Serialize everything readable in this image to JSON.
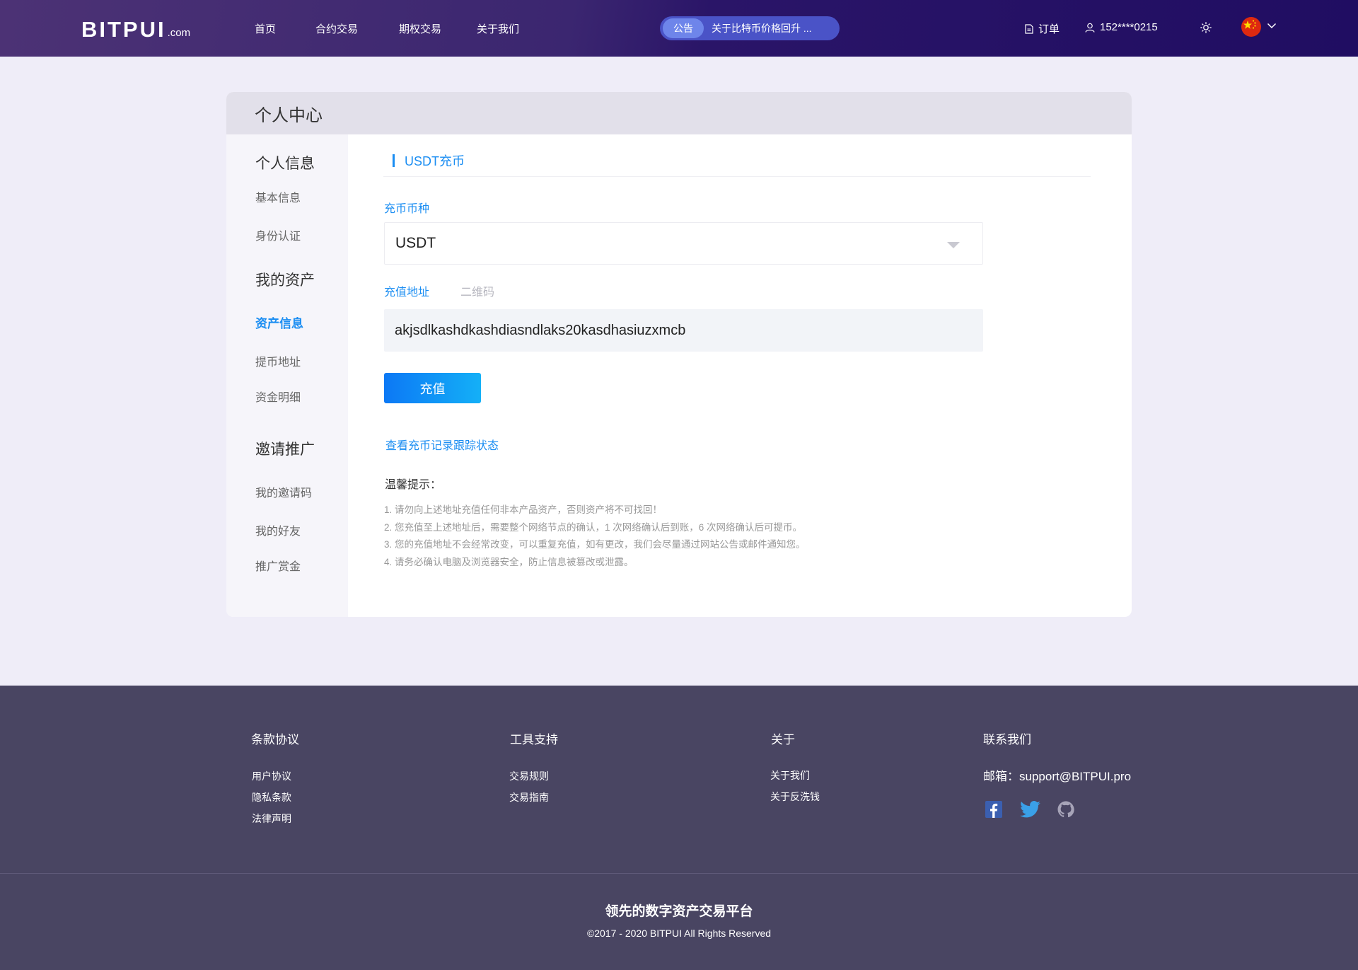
{
  "header": {
    "logo_main": "BITPUI",
    "logo_sub": ".com",
    "nav": [
      "首页",
      "合约交易",
      "期权交易",
      "关于我们"
    ],
    "notice_badge": "公告",
    "notice_text": "关于比特币价格回升 ...",
    "orders_label": "订单",
    "user_phone": "152****0215"
  },
  "card": {
    "title": "个人中心",
    "sidebar": {
      "group1": "个人信息",
      "basic_info": "基本信息",
      "identity": "身份认证",
      "group2": "我的资产",
      "asset_info": "资产信息",
      "withdraw_address": "提币地址",
      "fund_detail": "资金明细",
      "group3": "邀请推广",
      "invite_code": "我的邀请码",
      "friends": "我的好友",
      "reward": "推广赏金"
    },
    "section_title": "USDT充币",
    "currency_label": "充币币种",
    "currency_value": "USDT",
    "address_tab": "充值地址",
    "qrcode_tab": "二维码",
    "address_value": "akjsdlkashdkashdiasndlaks20kasdhasiuzxmcb",
    "deposit_button": "充值",
    "record_link": "查看充币记录跟踪状态",
    "tips_title": "温馨提示：",
    "tips": [
      "1. 请勿向上述地址充值任何非本产品资产，否则资产将不可找回！",
      "2. 您充值至上述地址后，需要整个网络节点的确认，1 次网络确认后到账，6 次网络确认后可提币。",
      "3. 您的充值地址不会经常改变，可以重复充值，如有更改，我们会尽量通过网站公告或邮件通知您。",
      "4. 请务必确认电脑及浏览器安全，防止信息被篡改或泄露。"
    ]
  },
  "footer": {
    "terms_title": "条款协议",
    "terms_links": [
      "用户协议",
      "隐私条款",
      "法律声明"
    ],
    "tools_title": "工具支持",
    "tools_links": [
      "交易规则",
      "交易指南"
    ],
    "about_title": "关于",
    "about_links": [
      "关于我们",
      "关于反洗钱"
    ],
    "contact_title": "联系我们",
    "email": "邮箱：support@BITPUI.pro",
    "slogan": "领先的数字资产交易平台",
    "copyright": "©2017 - 2020 BITPUI All Rights Reserved"
  },
  "colors": {
    "accent": "#1a8df2",
    "header_dark": "#200d62",
    "footer_bg": "#494562"
  }
}
